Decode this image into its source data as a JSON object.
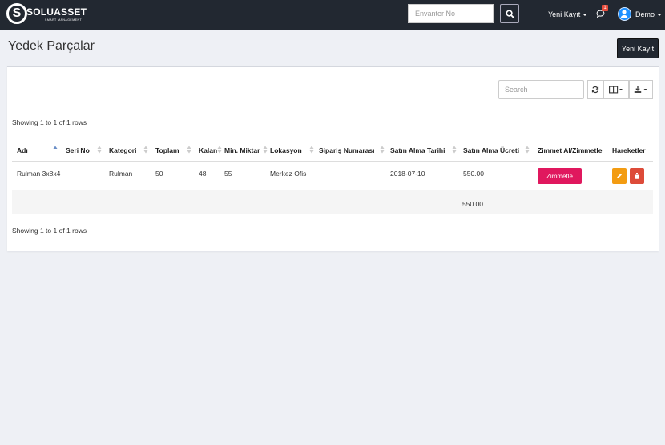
{
  "brand": {
    "name": "SOLUASSET",
    "tagline": "SMART MANAGEMENT",
    "letter": "S"
  },
  "navbar": {
    "search_placeholder": "Envanter No",
    "new_record": "Yeni Kayıt",
    "notification_count": "1",
    "user_name": "Demo"
  },
  "page": {
    "title": "Yedek Parçalar",
    "new_button": "Yeni Kayıt"
  },
  "table": {
    "search_placeholder": "Search",
    "rows_info_top": "Showing 1 to 1 of 1 rows",
    "rows_info_bottom": "Showing 1 to 1 of 1 rows",
    "columns": [
      "Adı",
      "Seri No",
      "Kategori",
      "Toplam",
      "Kalan",
      "Min. Miktar",
      "Lokasyon",
      "Sipariş Numarası",
      "Satın Alma Tarihi",
      "Satın Alma Ücreti",
      "Zimmet Al/Zimmetle",
      "Hareketler"
    ],
    "rows": [
      {
        "name": "Rulman 3x8x4",
        "serial": "",
        "category": "Rulman",
        "total": "50",
        "remaining": "48",
        "min_qty": "55",
        "location": "Merkez Ofis",
        "order_no": "",
        "purchase_date": "2018-07-10",
        "purchase_price": "550.00",
        "assign_label": "Zimmetle"
      }
    ],
    "footer": {
      "purchase_price_total": "550.00"
    }
  },
  "colors": {
    "navbar": "#222831",
    "assign": "#e0185e",
    "edit": "#f39c12",
    "delete": "#dd4b39",
    "avatar": "#1e90ff"
  },
  "icons": {
    "search": "search-icon",
    "refresh": "refresh-icon",
    "columns": "columns-icon",
    "export": "download-icon",
    "edit": "pencil-icon",
    "delete": "trash-icon",
    "notifications": "comment-icon",
    "user": "user-avatar-icon"
  }
}
